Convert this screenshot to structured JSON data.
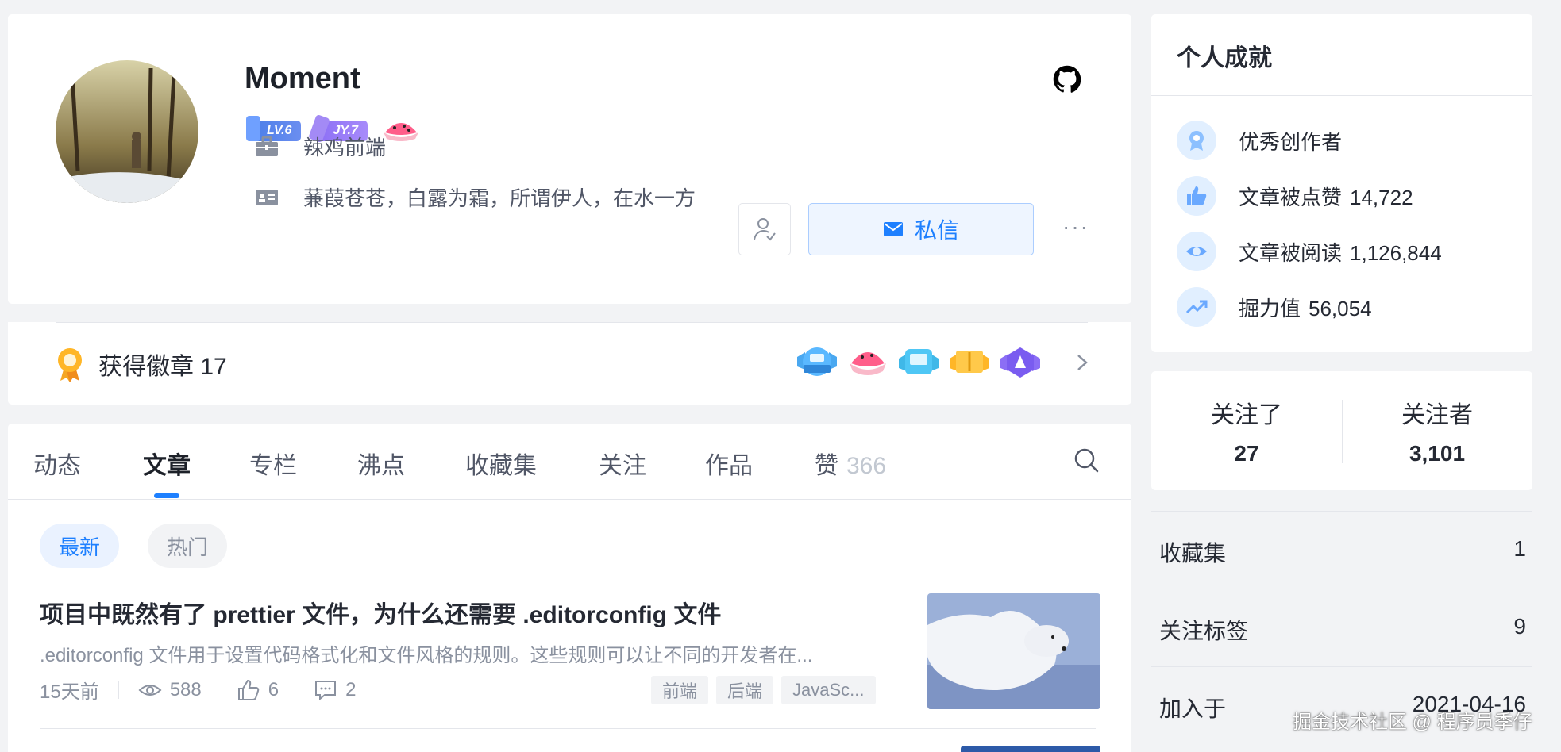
{
  "profile": {
    "username": "Moment",
    "level_badge": "LV.6",
    "jy_badge": "JY.7",
    "job": "辣鸡前端",
    "bio": "蒹葭苍苍，白露为霜，所谓伊人，在水一方",
    "message_button": "私信",
    "more": "···"
  },
  "badges": {
    "title": "获得徽章 17"
  },
  "tabs": [
    {
      "label": "动态"
    },
    {
      "label": "文章",
      "active": true
    },
    {
      "label": "专栏"
    },
    {
      "label": "沸点"
    },
    {
      "label": "收藏集"
    },
    {
      "label": "关注"
    },
    {
      "label": "作品"
    },
    {
      "label": "赞",
      "count": "366"
    }
  ],
  "filters": {
    "latest": "最新",
    "hot": "热门"
  },
  "article": {
    "title": "项目中既然有了 prettier 文件，为什么还需要 .editorconfig 文件",
    "desc": ".editorconfig 文件用于设置代码格式化和文件风格的规则。这些规则可以让不同的开发者在...",
    "time": "15天前",
    "views": "588",
    "likes": "6",
    "comments": "2",
    "tags": [
      "前端",
      "后端",
      "JavaSc..."
    ]
  },
  "achievements": {
    "title": "个人成就",
    "items": [
      {
        "label": "优秀创作者",
        "value": "",
        "icon": "award-icon"
      },
      {
        "label": "文章被点赞",
        "value": "14,722",
        "icon": "thumb-up-icon"
      },
      {
        "label": "文章被阅读",
        "value": "1,126,844",
        "icon": "eye-icon"
      },
      {
        "label": "掘力值",
        "value": "56,054",
        "icon": "trend-icon"
      }
    ]
  },
  "follow": {
    "following_label": "关注了",
    "following_value": "27",
    "followers_label": "关注者",
    "followers_value": "3,101"
  },
  "stats": [
    {
      "label": "收藏集",
      "value": "1"
    },
    {
      "label": "关注标签",
      "value": "9"
    },
    {
      "label": "加入于",
      "value": "2021-04-16"
    }
  ],
  "watermark": "掘金技术社区 @ 程序员季仔",
  "colors": {
    "accent": "#1e80ff",
    "background": "#f2f3f5",
    "text": "#252933",
    "muted": "#8a919f"
  }
}
